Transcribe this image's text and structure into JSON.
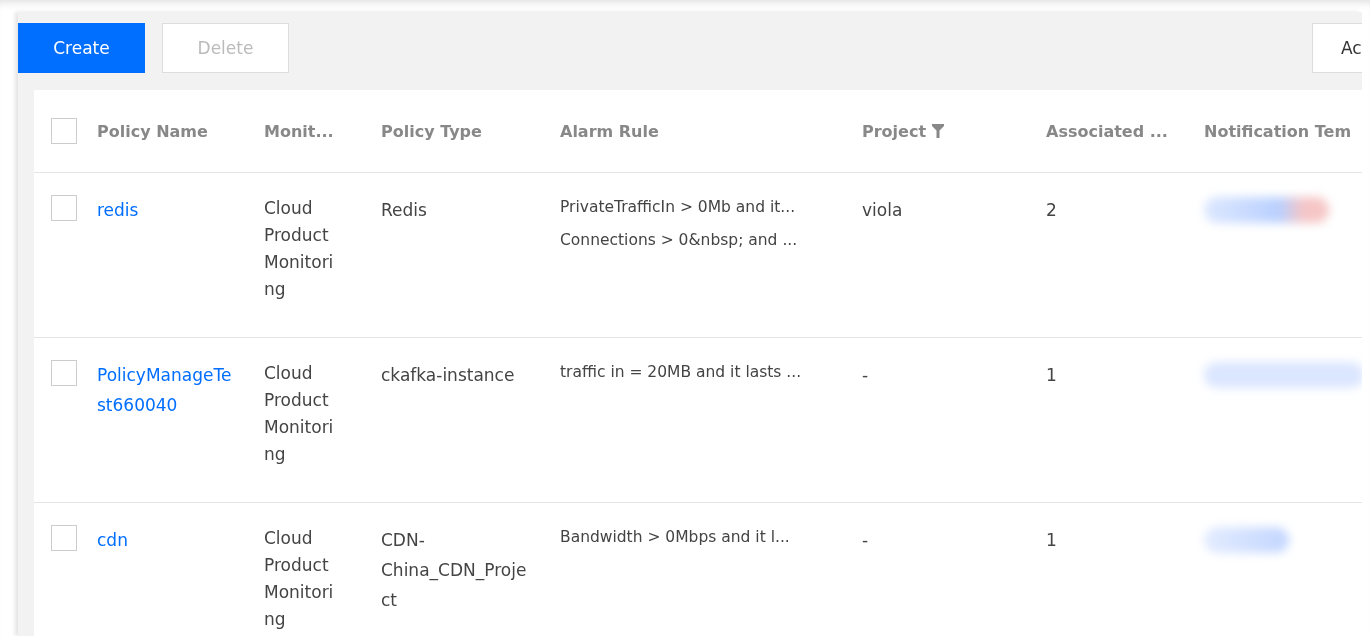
{
  "toolbar": {
    "buttons": [
      {
        "label": "Create",
        "kind": "primary",
        "disabled": false
      },
      {
        "label": "Delete",
        "kind": "default",
        "disabled": true
      }
    ],
    "right_button": {
      "label": "Ac"
    }
  },
  "table": {
    "select_all": {
      "checked": false
    },
    "columns": [
      {
        "label": "Policy Name",
        "filter": false
      },
      {
        "label": "Monit...",
        "filter": false
      },
      {
        "label": "Policy Type",
        "filter": false
      },
      {
        "label": "Alarm Rule",
        "filter": false
      },
      {
        "label": "Project",
        "filter": true
      },
      {
        "label": "Associated ...",
        "filter": false
      },
      {
        "label": "Notification Tem",
        "filter": false
      }
    ],
    "rows": [
      {
        "checked": false,
        "name": "redis",
        "monitor_type": "Cloud Product Monitoring",
        "policy_type": "Redis",
        "alarm_rules": [
          "PrivateTrafficIn > 0Mb and it...",
          "Connections > 0&nbsp; and ..."
        ],
        "project": "viola",
        "associated": "2",
        "notification_redacted": true
      },
      {
        "checked": false,
        "name": "PolicyManageTest660040",
        "monitor_type": "Cloud Product Monitoring",
        "policy_type": "ckafka-instance",
        "alarm_rules": [
          "traffic in = 20MB and it lasts ..."
        ],
        "project": "-",
        "associated": "1",
        "notification_redacted": true
      },
      {
        "checked": false,
        "name": "cdn",
        "monitor_type": "Cloud Product Monitoring",
        "policy_type": "CDN-China_CDN_Project",
        "alarm_rules": [
          "Bandwidth > 0Mbps and it l..."
        ],
        "project": "-",
        "associated": "1",
        "notification_redacted": true
      }
    ]
  }
}
